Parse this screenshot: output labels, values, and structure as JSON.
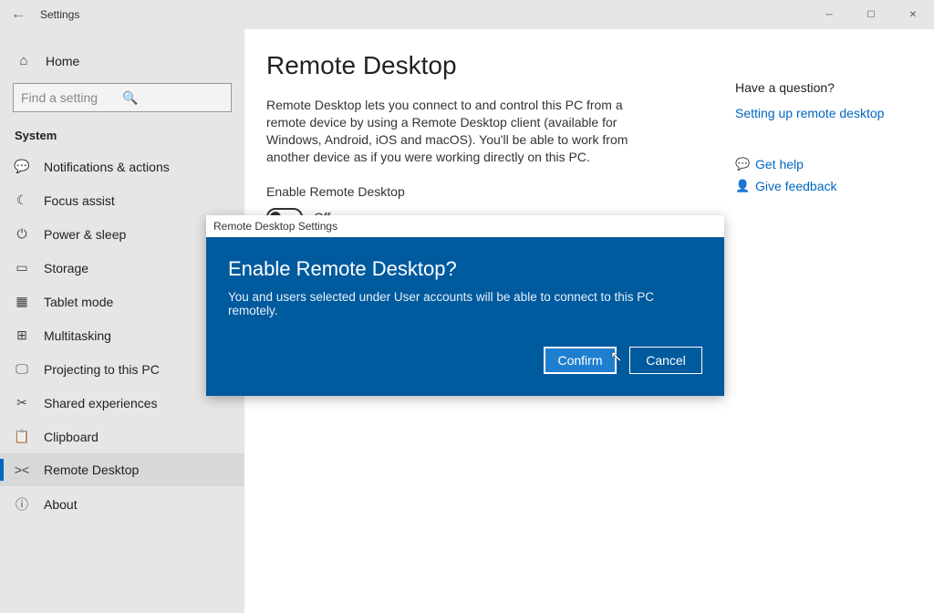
{
  "titlebar": {
    "title": "Settings"
  },
  "sidebar": {
    "home": "Home",
    "search_placeholder": "Find a setting",
    "heading": "System",
    "items": [
      {
        "label": "Notifications & actions",
        "icon": "💬"
      },
      {
        "label": "Focus assist",
        "icon": "☾"
      },
      {
        "label": "Power & sleep",
        "icon": "⏻"
      },
      {
        "label": "Storage",
        "icon": "▭"
      },
      {
        "label": "Tablet mode",
        "icon": "▦"
      },
      {
        "label": "Multitasking",
        "icon": "⊞"
      },
      {
        "label": "Projecting to this PC",
        "icon": "🖵"
      },
      {
        "label": "Shared experiences",
        "icon": "✂"
      },
      {
        "label": "Clipboard",
        "icon": "📋"
      },
      {
        "label": "Remote Desktop",
        "icon": "><"
      },
      {
        "label": "About",
        "icon": "ⓘ"
      }
    ],
    "active_index": 9
  },
  "main": {
    "heading": "Remote Desktop",
    "description": "Remote Desktop lets you connect to and control this PC from a remote device by using a Remote Desktop client (available for Windows, Android, iOS and macOS). You'll be able to work from another device as if you were working directly on this PC.",
    "toggle_label": "Enable Remote Desktop",
    "toggle_state": "Off"
  },
  "right_rail": {
    "question": "Have a question?",
    "link1": "Setting up remote desktop",
    "help": "Get help",
    "feedback": "Give feedback"
  },
  "dialog": {
    "window_title": "Remote Desktop Settings",
    "title": "Enable Remote Desktop?",
    "body": "You and users selected under User accounts will be able to connect to this PC remotely.",
    "confirm": "Confirm",
    "cancel": "Cancel"
  }
}
